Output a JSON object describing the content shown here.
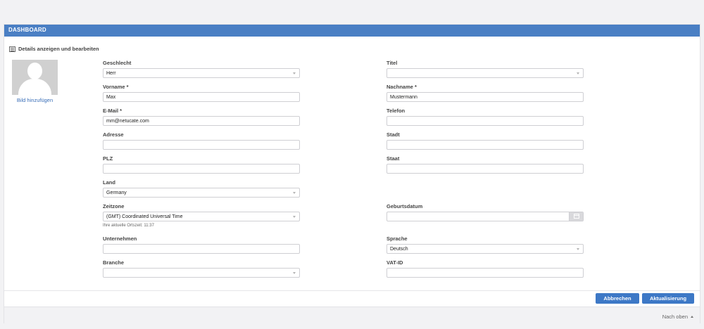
{
  "header": {
    "title": "DASHBOARD"
  },
  "section": {
    "title": "Details anzeigen und bearbeiten"
  },
  "avatar": {
    "add_label": "Bild hinzufügen"
  },
  "fields": {
    "geschlecht": {
      "label": "Geschlecht",
      "value": "Herr"
    },
    "titel": {
      "label": "Titel",
      "value": ""
    },
    "vorname": {
      "label": "Vorname *",
      "value": "Max"
    },
    "nachname": {
      "label": "Nachname *",
      "value": "Mustermann"
    },
    "email": {
      "label": "E-Mail *",
      "value": "mm@netucate.com"
    },
    "telefon": {
      "label": "Telefon",
      "value": ""
    },
    "adresse": {
      "label": "Adresse",
      "value": ""
    },
    "stadt": {
      "label": "Stadt",
      "value": ""
    },
    "plz": {
      "label": "PLZ",
      "value": ""
    },
    "staat": {
      "label": "Staat",
      "value": ""
    },
    "land": {
      "label": "Land",
      "value": "Germany"
    },
    "zeitzone": {
      "label": "Zeitzone",
      "value": "(GMT) Coordinated Universal Time",
      "hint": "Ihre aktuelle Ortszeit: 11:37"
    },
    "geburtsdatum": {
      "label": "Geburtsdatum",
      "value": ""
    },
    "unternehmen": {
      "label": "Unternehmen",
      "value": ""
    },
    "sprache": {
      "label": "Sprache",
      "value": "Deutsch"
    },
    "branche": {
      "label": "Branche",
      "value": ""
    },
    "vatid": {
      "label": "VAT-ID",
      "value": ""
    }
  },
  "buttons": {
    "cancel": "Abbrechen",
    "update": "Aktualisierung"
  },
  "footer": {
    "top_link": "Nach oben"
  },
  "colors": {
    "accent": "#4a7fc4",
    "button": "#3d78c6"
  }
}
